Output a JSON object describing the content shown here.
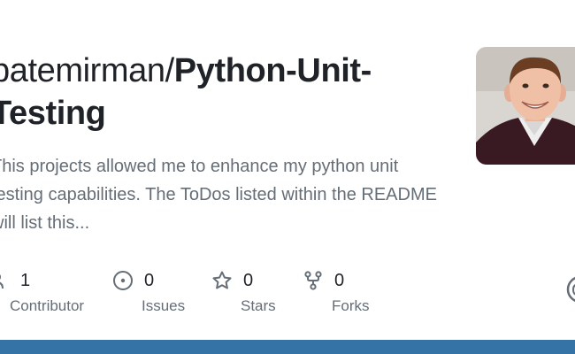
{
  "repo": {
    "owner": "batemirman/",
    "name": "Python-Unit-Testing",
    "description": "This projects allowed me to enhance my python unit testing capabilities. The ToDos listed within the README will list this..."
  },
  "stats": [
    {
      "icon": "people-icon",
      "value": "1",
      "label": "Contributor"
    },
    {
      "icon": "issue-icon",
      "value": "0",
      "label": "Issues"
    },
    {
      "icon": "star-icon",
      "value": "0",
      "label": "Stars"
    },
    {
      "icon": "fork-icon",
      "value": "0",
      "label": "Forks"
    }
  ],
  "colors": {
    "language_bar": "#3572a5",
    "text_primary": "#1f2328",
    "text_muted": "#656d76"
  }
}
